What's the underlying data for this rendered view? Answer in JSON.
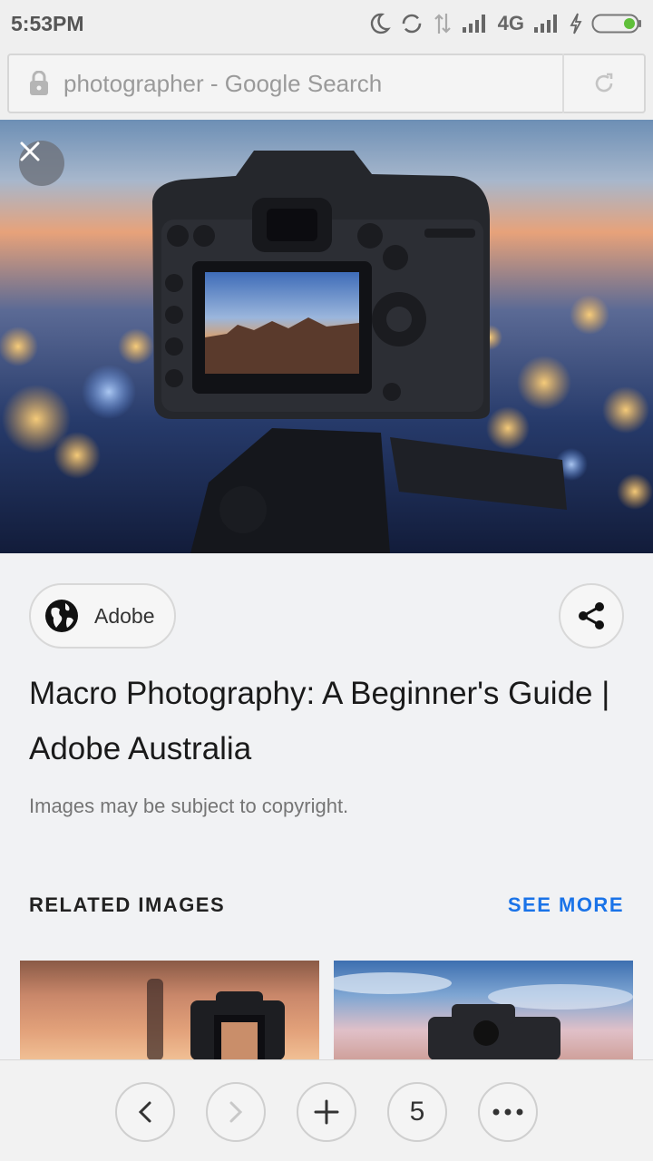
{
  "status_bar": {
    "time": "5:53PM",
    "network": "4G",
    "icons": [
      "moon-icon",
      "sync-icon",
      "data-arrows-icon",
      "signal-icon",
      "signal-icon",
      "charging-icon",
      "battery-icon"
    ]
  },
  "address_bar": {
    "url_text": "photographer - Google Search",
    "icons": [
      "lock-icon",
      "reload-icon"
    ]
  },
  "viewer": {
    "close_icon": "close-icon",
    "source_name": "Adobe",
    "source_icon": "globe-icon",
    "share_icon": "share-icon",
    "title": "Macro Photography: A Beginner's Guide | Adobe Australia",
    "copyright_note": "Images may be subject to copyright."
  },
  "related": {
    "heading": "RELATED IMAGES",
    "see_more": "SEE MORE",
    "accent_color": "#1a73e8"
  },
  "toolbar": {
    "tab_count": "5",
    "icons": [
      "back-icon",
      "forward-icon",
      "new-tab-icon",
      "more-icon"
    ]
  }
}
